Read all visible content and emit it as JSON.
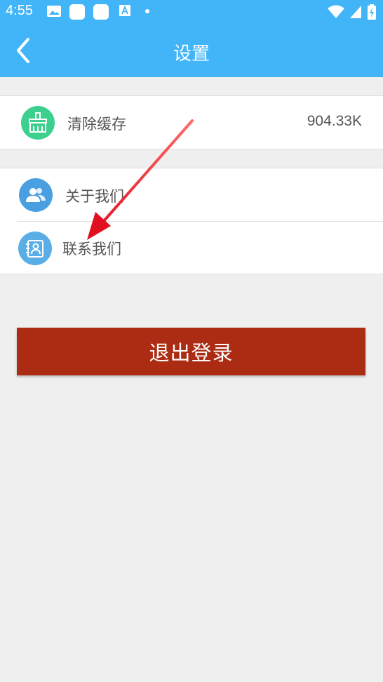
{
  "status_bar": {
    "time": "4:55",
    "icons": [
      "image-icon",
      "square-icon",
      "square-icon",
      "font-icon",
      "dot-icon",
      "wifi-icon",
      "signal-icon",
      "battery-charging-icon"
    ]
  },
  "header": {
    "title": "设置",
    "back_icon": "chevron-left-icon",
    "background": "#41b5f8"
  },
  "cache_item": {
    "label": "清除缓存",
    "value": "904.33K",
    "icon": "broom-icon",
    "icon_color": "#3ccf8e"
  },
  "about_item": {
    "label": "关于我们",
    "icon": "users-icon",
    "icon_color": "#4a9fe0"
  },
  "contact_item": {
    "label": "联系我们",
    "icon": "contact-book-icon",
    "icon_color": "#5aaee6"
  },
  "logout_button": {
    "label": "退出登录",
    "color": "#ac2c13"
  },
  "annotation": {
    "arrow_color": "#e01020"
  }
}
